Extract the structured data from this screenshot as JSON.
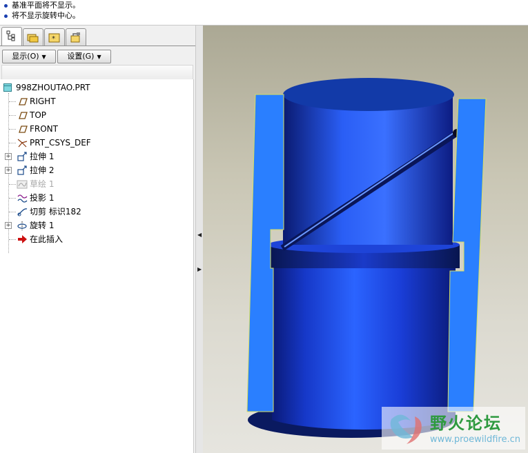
{
  "messages": [
    "基准平面将不显示。",
    "将不显示旋转中心。"
  ],
  "tabs": [
    {
      "icon": "model-tree-icon",
      "active": true
    },
    {
      "icon": "folder-browser-icon",
      "active": false
    },
    {
      "icon": "favorites-icon",
      "active": false
    },
    {
      "icon": "connections-icon",
      "active": false
    }
  ],
  "toolbar": {
    "show_label": "显示(O)",
    "settings_label": "设置(G)"
  },
  "tree": {
    "root": "998ZHOUTAO.PRT",
    "items": [
      {
        "label": "RIGHT",
        "icon": "datum-plane-icon"
      },
      {
        "label": "TOP",
        "icon": "datum-plane-icon"
      },
      {
        "label": "FRONT",
        "icon": "datum-plane-icon"
      },
      {
        "label": "PRT_CSYS_DEF",
        "icon": "coordinate-system-icon"
      },
      {
        "label": "拉伸 1",
        "icon": "extrude-icon",
        "expandable": true
      },
      {
        "label": "拉伸 2",
        "icon": "extrude-icon",
        "expandable": true
      },
      {
        "label": "草绘 1",
        "icon": "sketch-icon",
        "suppressed": true
      },
      {
        "label": "投影 1",
        "icon": "projection-icon"
      },
      {
        "label": "切剪 标识182",
        "icon": "cut-icon"
      },
      {
        "label": "旋转 1",
        "icon": "revolve-icon",
        "expandable": true
      },
      {
        "label": "在此插入",
        "icon": "insert-here-arrow-icon"
      }
    ]
  },
  "watermark": {
    "title": "野火论坛",
    "url": "www.proewildfire.cn"
  },
  "colors": {
    "part_light": "#2a7fff",
    "part_dark": "#0a1a7a",
    "viewport_top": "#aba894",
    "viewport_bottom": "#e6e5df"
  }
}
